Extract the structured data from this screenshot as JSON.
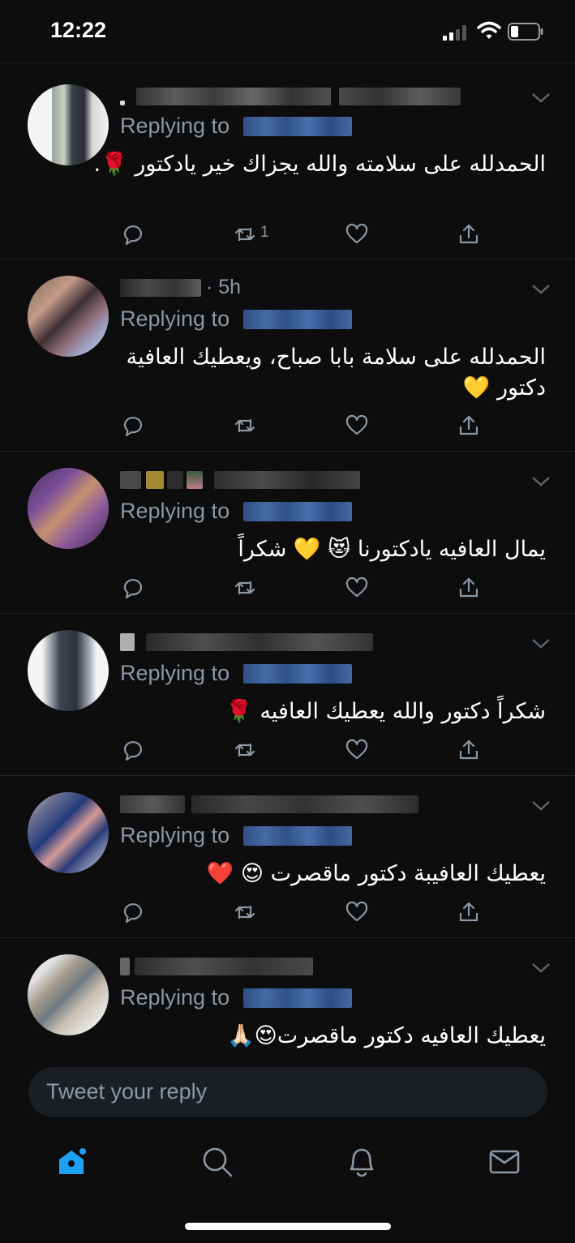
{
  "status_bar": {
    "time": "12:22"
  },
  "replies": [
    {
      "handle_time": "",
      "replying_label": "Replying to",
      "text": "الحمدلله على سلامته والله يجزاك خير يادكتور 🌹.",
      "retweet_count": "1"
    },
    {
      "handle_time": "· 5h",
      "replying_label": "Replying to",
      "text": "الحمدلله على سلامة بابا صباح، ويعطيك العافية دكتور 💛",
      "retweet_count": ""
    },
    {
      "handle_time": "",
      "replying_label": "Replying to",
      "text": "يمال العافيه يادكتورنا 😻 💛 شكراً",
      "retweet_count": ""
    },
    {
      "handle_time": "",
      "replying_label": "Replying to",
      "text": "شكراً دكتور  والله يعطيك العافيه 🌹",
      "retweet_count": ""
    },
    {
      "handle_time": "",
      "replying_label": "Replying to",
      "text": "يعطيك العافيبة دكتور ماقصرت 😍 ❤️",
      "retweet_count": ""
    },
    {
      "handle_time": "",
      "replying_label": "Replying to",
      "text": "يعطيك العافيه دكتور ماقصرت😍🙏🏻",
      "retweet_count": ""
    }
  ],
  "compose": {
    "placeholder": "Tweet your reply"
  },
  "tabbar": {
    "items": [
      "home-icon",
      "search-icon",
      "notifications-icon",
      "messages-icon"
    ],
    "active_color": "#1da1f2"
  },
  "colors": {
    "background": "#0d0d0d",
    "muted": "#8b98a5",
    "divider": "#222222"
  }
}
